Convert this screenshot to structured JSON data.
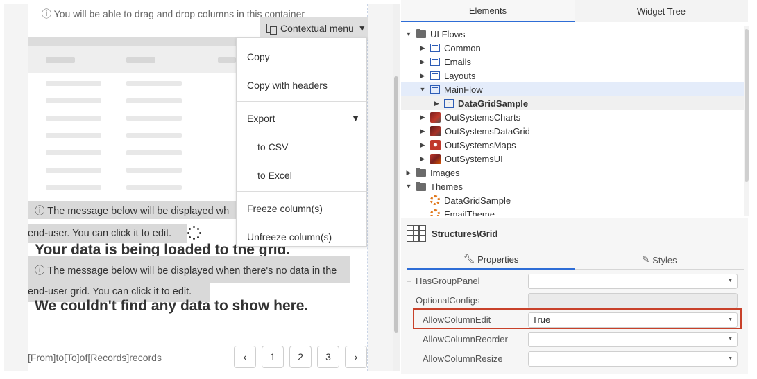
{
  "canvas": {
    "info_top": "ⓘ You will be able to drag and drop columns in this container",
    "contextual_menu_button": "Contextual menu",
    "menu": {
      "copy": "Copy",
      "copy_with_headers": "Copy with headers",
      "export": "Export",
      "to_csv": "to CSV",
      "to_excel": "to Excel",
      "freeze": "Freeze column(s)",
      "unfreeze": "Unfreeze column(s)"
    },
    "loading_msg_line1": "ⓘ The message below will be displayed wh",
    "loading_msg_line2": "end-user. You can click it to edit.",
    "loading_big": "Your data is being loaded to the grid.",
    "empty_msg_line1": "ⓘ The message below will be displayed when there's no data in the",
    "empty_msg_line2": "end-user grid. You can click it to edit.",
    "empty_big": "We couldn't find any data to show here.",
    "footer_text": "[From]to[To]of[Records]records",
    "pagination": {
      "prev": "‹",
      "pages": [
        "1",
        "2",
        "3"
      ],
      "next": "›"
    }
  },
  "panel": {
    "tabs": [
      "Elements",
      "Widget Tree"
    ],
    "tree": [
      {
        "label": "UI Flows",
        "caret": "▼",
        "icon": "folder-icon"
      },
      {
        "label": "Common",
        "caret": "▶",
        "icon": "flow-icon"
      },
      {
        "label": "Emails",
        "caret": "▶",
        "icon": "flow-icon"
      },
      {
        "label": "Layouts",
        "caret": "▶",
        "icon": "flow-icon"
      },
      {
        "label": "MainFlow",
        "caret": "▼",
        "icon": "flow-icon"
      },
      {
        "label": "DataGridSample",
        "caret": "▶",
        "icon": "screen-icon"
      },
      {
        "label": "OutSystemsCharts",
        "caret": "▶",
        "icon": "charts-icon"
      },
      {
        "label": "OutSystemsDataGrid",
        "caret": "▶",
        "icon": "datagrid-icon"
      },
      {
        "label": "OutSystemsMaps",
        "caret": "▶",
        "icon": "maps-icon"
      },
      {
        "label": "OutSystemsUI",
        "caret": "▶",
        "icon": "ui-icon"
      },
      {
        "label": "Images",
        "caret": "▶",
        "icon": "folder-icon"
      },
      {
        "label": "Themes",
        "caret": "▼",
        "icon": "folder-icon"
      },
      {
        "label": "DataGridSample",
        "caret": "",
        "icon": "theme-icon"
      },
      {
        "label": "EmailTheme",
        "caret": "",
        "icon": "theme-icon"
      }
    ],
    "structure_title": "Structures\\Grid",
    "prop_tabs": [
      "Properties",
      "Styles"
    ],
    "properties": [
      {
        "name": "HasGroupPanel",
        "value": ""
      },
      {
        "name": "OptionalConfigs",
        "value": ""
      },
      {
        "name": "AllowColumnEdit",
        "value": "True"
      },
      {
        "name": "AllowColumnReorder",
        "value": ""
      },
      {
        "name": "AllowColumnResize",
        "value": ""
      }
    ]
  },
  "colors": {
    "accent": "#2e6dd6",
    "highlight_border": "#c8412a"
  }
}
